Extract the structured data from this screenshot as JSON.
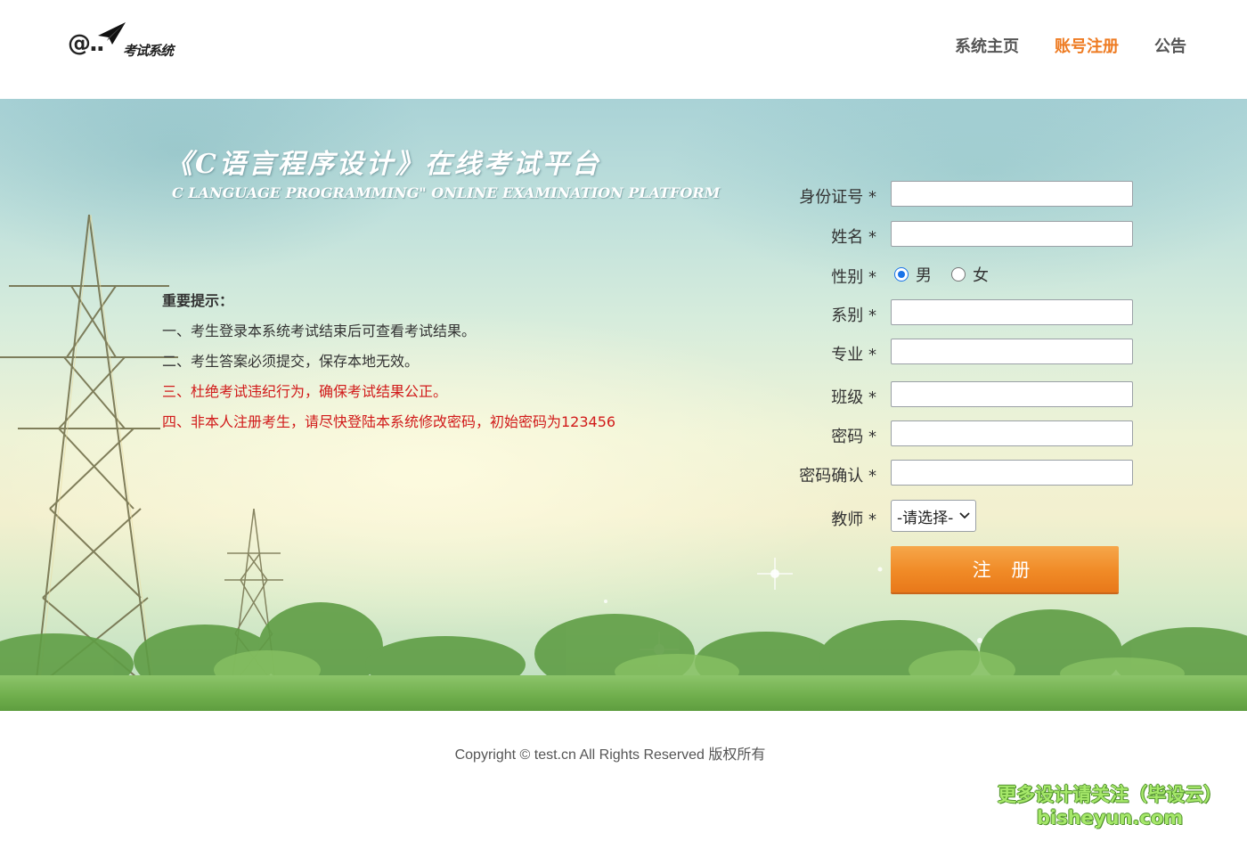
{
  "header": {
    "logo_text": "考试系统",
    "nav": [
      {
        "label": "系统主页",
        "active": false
      },
      {
        "label": "账号注册",
        "active": true
      },
      {
        "label": "公告",
        "active": false
      }
    ]
  },
  "banner": {
    "title_cn": "《C语言程序设计》在线考试平台",
    "title_en": "C LANGUAGE PROGRAMMING\" ONLINE EXAMINATION PLATFORM",
    "notice": {
      "heading": "重要提示：",
      "items": [
        {
          "text": "一、考生登录本系统考试结束后可查看考试结果。",
          "color": "#333333"
        },
        {
          "text": "二、考生答案必须提交，保存本地无效。",
          "color": "#333333"
        },
        {
          "text": "三、杜绝考试违纪行为，确保考试结果公正。",
          "color": "#d11a1a"
        },
        {
          "text": "四、非本人注册考生，请尽快登陆本系统修改密码，初始密码为123456",
          "color": "#d11a1a"
        }
      ]
    }
  },
  "form": {
    "id_label": "身份证号 *",
    "id_value": "",
    "name_label": "姓名 *",
    "name_value": "",
    "gender_label": "性别 *",
    "gender_options": [
      "男",
      "女"
    ],
    "gender_selected": "男",
    "dept_label": "系别 *",
    "dept_value": "",
    "major_label": "专业 *",
    "major_value": "",
    "class_label": "班级 *",
    "class_value": "",
    "password_label": "密码 *",
    "password_value": "",
    "confirm_label": "密码确认 *",
    "confirm_value": "",
    "teacher_label": "教师 *",
    "teacher_selected": "-请选择-",
    "submit_label": "注 册"
  },
  "footer": {
    "copyright": "Copyright © test.cn All Rights Reserved 版权所有"
  },
  "watermark": {
    "line1": "更多设计请关注（毕设云）",
    "line2": "bisheyun.com"
  },
  "colors": {
    "accent": "#ee7b22",
    "button": "#f08a26",
    "notice_red": "#d11a1a"
  }
}
